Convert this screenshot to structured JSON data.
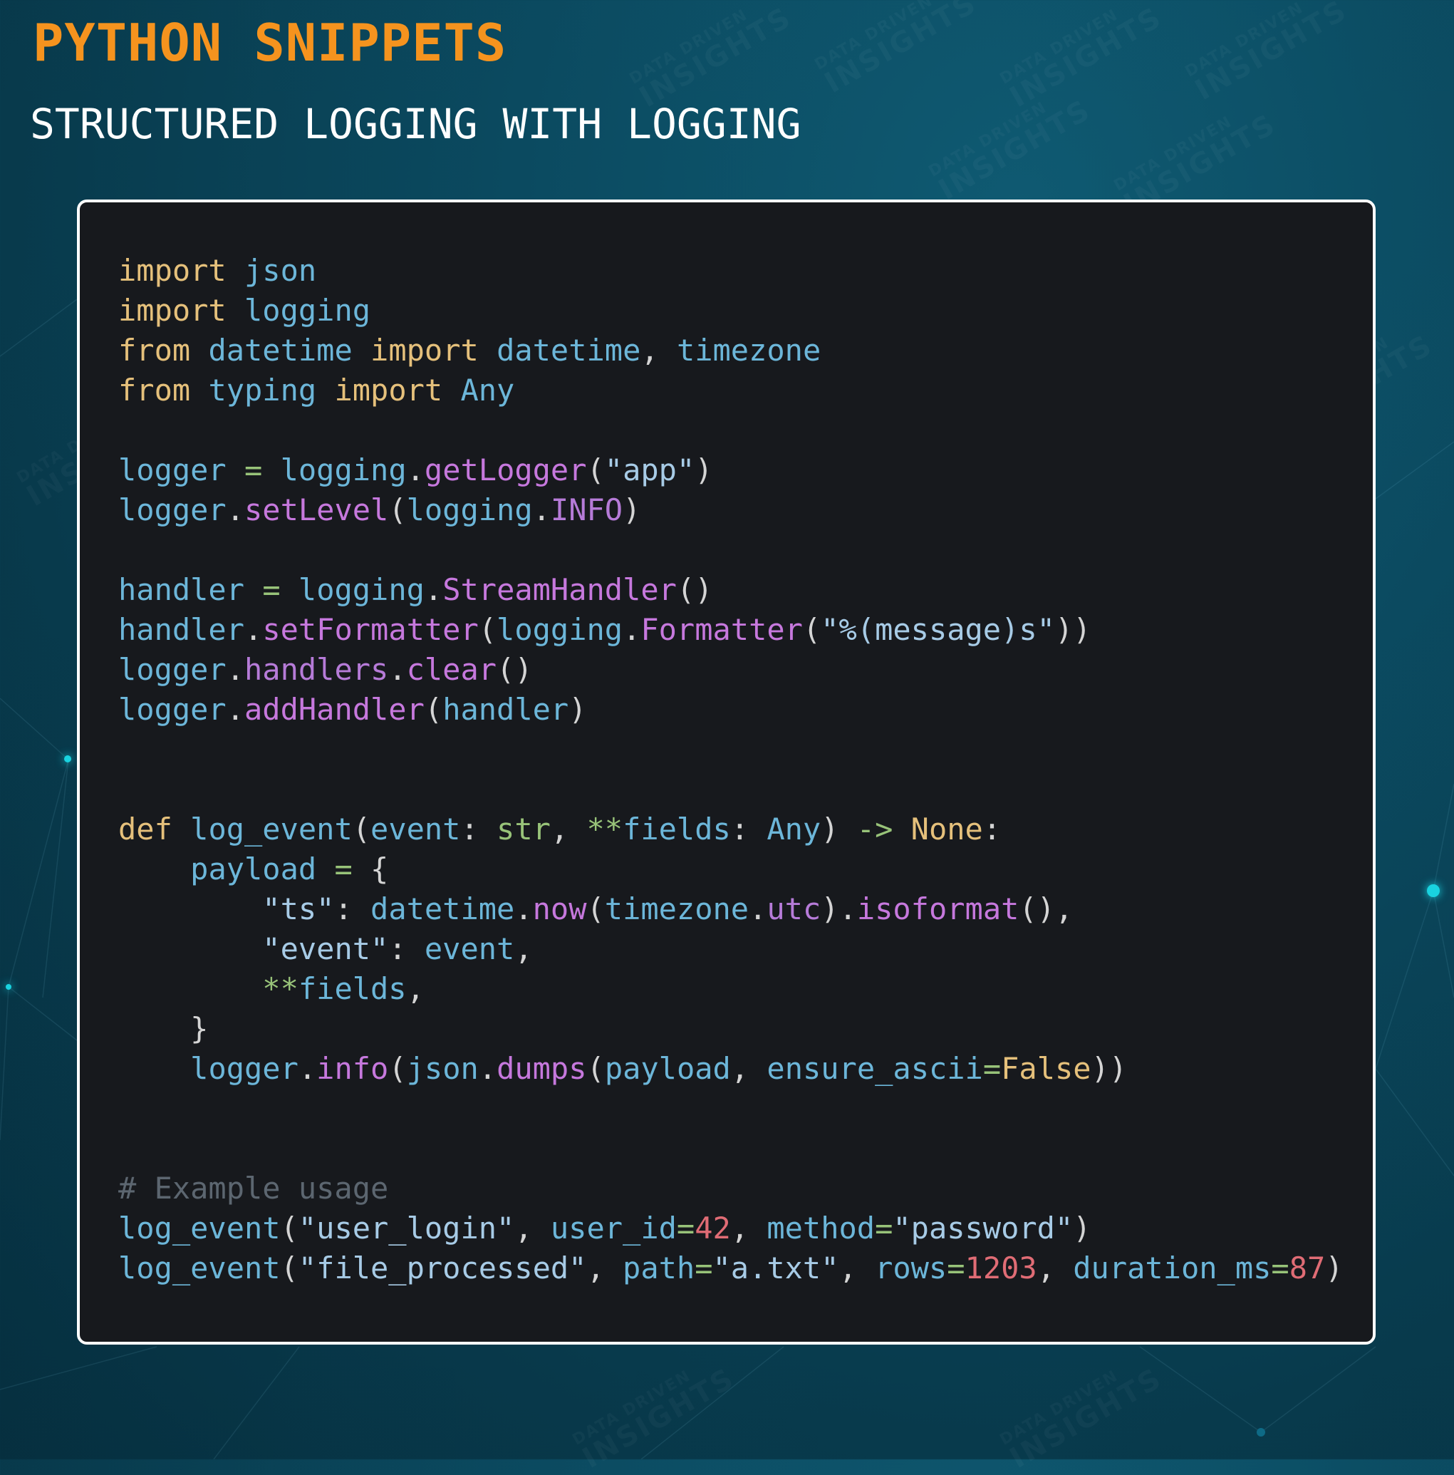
{
  "header": {
    "title": "PYTHON SNIPPETS",
    "subtitle": "STRUCTURED LOGGING WITH LOGGING"
  },
  "watermark": {
    "line1": "DATA DRIVEN",
    "line2": "INSIGHTS"
  },
  "colors": {
    "background": "#0b4a60",
    "title": "#f5931e",
    "code_background": "#17191d",
    "keyword": "#e5c07b",
    "identifier": "#6cb6d9",
    "method": "#c678dd",
    "number": "#e06c75",
    "comment": "#5c6670"
  },
  "code": {
    "language": "python",
    "lines": [
      [
        [
          "kw",
          "import"
        ],
        [
          "pun",
          " "
        ],
        [
          "id",
          "json"
        ]
      ],
      [
        [
          "kw",
          "import"
        ],
        [
          "pun",
          " "
        ],
        [
          "id",
          "logging"
        ]
      ],
      [
        [
          "kw",
          "from"
        ],
        [
          "pun",
          " "
        ],
        [
          "id",
          "datetime"
        ],
        [
          "pun",
          " "
        ],
        [
          "kw",
          "import"
        ],
        [
          "pun",
          " "
        ],
        [
          "id",
          "datetime"
        ],
        [
          "pun",
          ", "
        ],
        [
          "id",
          "timezone"
        ]
      ],
      [
        [
          "kw",
          "from"
        ],
        [
          "pun",
          " "
        ],
        [
          "id",
          "typing"
        ],
        [
          "pun",
          " "
        ],
        [
          "kw",
          "import"
        ],
        [
          "pun",
          " "
        ],
        [
          "id",
          "Any"
        ]
      ],
      [],
      [
        [
          "id",
          "logger"
        ],
        [
          "pun",
          " "
        ],
        [
          "op",
          "="
        ],
        [
          "pun",
          " "
        ],
        [
          "id",
          "logging"
        ],
        [
          "pun",
          "."
        ],
        [
          "fn",
          "getLogger"
        ],
        [
          "pun",
          "("
        ],
        [
          "str",
          "\"app\""
        ],
        [
          "pun",
          ")"
        ]
      ],
      [
        [
          "id",
          "logger"
        ],
        [
          "pun",
          "."
        ],
        [
          "fn",
          "setLevel"
        ],
        [
          "pun",
          "("
        ],
        [
          "id",
          "logging"
        ],
        [
          "pun",
          "."
        ],
        [
          "att",
          "INFO"
        ],
        [
          "pun",
          ")"
        ]
      ],
      [],
      [
        [
          "id",
          "handler"
        ],
        [
          "pun",
          " "
        ],
        [
          "op",
          "="
        ],
        [
          "pun",
          " "
        ],
        [
          "id",
          "logging"
        ],
        [
          "pun",
          "."
        ],
        [
          "fn",
          "StreamHandler"
        ],
        [
          "pun",
          "()"
        ]
      ],
      [
        [
          "id",
          "handler"
        ],
        [
          "pun",
          "."
        ],
        [
          "fn",
          "setFormatter"
        ],
        [
          "pun",
          "("
        ],
        [
          "id",
          "logging"
        ],
        [
          "pun",
          "."
        ],
        [
          "fn",
          "Formatter"
        ],
        [
          "pun",
          "("
        ],
        [
          "str",
          "\"%(message)s\""
        ],
        [
          "pun",
          "))"
        ]
      ],
      [
        [
          "id",
          "logger"
        ],
        [
          "pun",
          "."
        ],
        [
          "att",
          "handlers"
        ],
        [
          "pun",
          "."
        ],
        [
          "fn",
          "clear"
        ],
        [
          "pun",
          "()"
        ]
      ],
      [
        [
          "id",
          "logger"
        ],
        [
          "pun",
          "."
        ],
        [
          "fn",
          "addHandler"
        ],
        [
          "pun",
          "("
        ],
        [
          "id",
          "handler"
        ],
        [
          "pun",
          ")"
        ]
      ],
      [],
      [],
      [
        [
          "kw",
          "def"
        ],
        [
          "pun",
          " "
        ],
        [
          "id",
          "log_event"
        ],
        [
          "pun",
          "("
        ],
        [
          "id",
          "event"
        ],
        [
          "pun",
          ": "
        ],
        [
          "typ",
          "str"
        ],
        [
          "pun",
          ", "
        ],
        [
          "op",
          "**"
        ],
        [
          "id",
          "fields"
        ],
        [
          "pun",
          ": "
        ],
        [
          "id",
          "Any"
        ],
        [
          "pun",
          ") "
        ],
        [
          "op",
          "->"
        ],
        [
          "pun",
          " "
        ],
        [
          "cst",
          "None"
        ],
        [
          "pun",
          ":"
        ]
      ],
      [
        [
          "pun",
          "    "
        ],
        [
          "id",
          "payload"
        ],
        [
          "pun",
          " "
        ],
        [
          "op",
          "="
        ],
        [
          "pun",
          " {"
        ]
      ],
      [
        [
          "pun",
          "        "
        ],
        [
          "str",
          "\"ts\""
        ],
        [
          "pun",
          ": "
        ],
        [
          "id",
          "datetime"
        ],
        [
          "pun",
          "."
        ],
        [
          "fn",
          "now"
        ],
        [
          "pun",
          "("
        ],
        [
          "id",
          "timezone"
        ],
        [
          "pun",
          "."
        ],
        [
          "att",
          "utc"
        ],
        [
          "pun",
          ")."
        ],
        [
          "fn",
          "isoformat"
        ],
        [
          "pun",
          "(),"
        ]
      ],
      [
        [
          "pun",
          "        "
        ],
        [
          "str",
          "\"event\""
        ],
        [
          "pun",
          ": "
        ],
        [
          "id",
          "event"
        ],
        [
          "pun",
          ","
        ]
      ],
      [
        [
          "pun",
          "        "
        ],
        [
          "op",
          "**"
        ],
        [
          "id",
          "fields"
        ],
        [
          "pun",
          ","
        ]
      ],
      [
        [
          "pun",
          "    }"
        ]
      ],
      [
        [
          "pun",
          "    "
        ],
        [
          "id",
          "logger"
        ],
        [
          "pun",
          "."
        ],
        [
          "fn",
          "info"
        ],
        [
          "pun",
          "("
        ],
        [
          "id",
          "json"
        ],
        [
          "pun",
          "."
        ],
        [
          "fn",
          "dumps"
        ],
        [
          "pun",
          "("
        ],
        [
          "id",
          "payload"
        ],
        [
          "pun",
          ", "
        ],
        [
          "id",
          "ensure_ascii"
        ],
        [
          "op",
          "="
        ],
        [
          "cst",
          "False"
        ],
        [
          "pun",
          "))"
        ]
      ],
      [],
      [],
      [
        [
          "cmt",
          "# Example usage"
        ]
      ],
      [
        [
          "id",
          "log_event"
        ],
        [
          "pun",
          "("
        ],
        [
          "str",
          "\"user_login\""
        ],
        [
          "pun",
          ", "
        ],
        [
          "id",
          "user_id"
        ],
        [
          "op",
          "="
        ],
        [
          "num",
          "42"
        ],
        [
          "pun",
          ", "
        ],
        [
          "id",
          "method"
        ],
        [
          "op",
          "="
        ],
        [
          "str",
          "\"password\""
        ],
        [
          "pun",
          ")"
        ]
      ],
      [
        [
          "id",
          "log_event"
        ],
        [
          "pun",
          "("
        ],
        [
          "str",
          "\"file_processed\""
        ],
        [
          "pun",
          ", "
        ],
        [
          "id",
          "path"
        ],
        [
          "op",
          "="
        ],
        [
          "str",
          "\"a.txt\""
        ],
        [
          "pun",
          ", "
        ],
        [
          "id",
          "rows"
        ],
        [
          "op",
          "="
        ],
        [
          "num",
          "1203"
        ],
        [
          "pun",
          ", "
        ],
        [
          "id",
          "duration_ms"
        ],
        [
          "op",
          "="
        ],
        [
          "num",
          "87"
        ],
        [
          "pun",
          ")"
        ]
      ]
    ]
  }
}
